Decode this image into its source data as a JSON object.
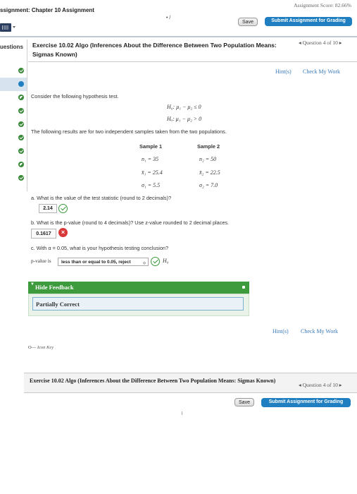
{
  "header": {
    "assignment_title": "ssignment: Chapter 10 Assignment",
    "score": "Assignment Score: 82.66%",
    "dots": "• /",
    "save_label": "Save",
    "submit_label": "Submit Assignment for Grading"
  },
  "sidebar": {
    "label": "uestions",
    "items": [
      {
        "status": "correct"
      },
      {
        "status": "current"
      },
      {
        "status": "partial"
      },
      {
        "status": "correct"
      },
      {
        "status": "correct"
      },
      {
        "status": "correct"
      },
      {
        "status": "correct"
      },
      {
        "status": "partial"
      },
      {
        "status": "correct"
      }
    ]
  },
  "exercise": {
    "title": "Exercise 10.02 Algo (Inferences About the Difference Between Two Population Means: Sigmas Known)",
    "question_nav": "◂ Question 4 of 10 ▸",
    "hints_label": "Hint(s)",
    "check_label": "Check My Work",
    "intro": "Consider the following hypothesis test.",
    "h0": "H₀: μ₁ − μ₂ ≤ 0",
    "ha": "Hₐ: μ₁ − μ₂ > 0",
    "samples_intro": "The following results are for two independent samples taken from the two populations.",
    "sample1_header": "Sample 1",
    "sample2_header": "Sample 2",
    "n1": "n₁ = 35",
    "n2": "n₂ = 50",
    "xbar1": "x̄₁ = 25.4",
    "xbar2": "x̄₂ = 22.5",
    "sigma1": "σ₁ = 5.5",
    "sigma2": "σ₂ = 7.0",
    "part_a": "a. What is the value of the test statistic (round to 2 decimals)?",
    "answer_a": "2.14",
    "part_b": "b. What is the p-value (round to 4 decimals)? Use z-value rounded to 2 decimal places.",
    "answer_b": "0.1617",
    "part_c": "c. With α = 0.05, what is your hypothesis testing conclusion?",
    "pvalue_label": "p-value is",
    "conclusion_select": "less than or equal to 0.05, reject",
    "h0_short": "H₀",
    "feedback_toggle": "Hide Feedback",
    "feedback_result": "Partially Correct",
    "icon_key": "Icon Key"
  },
  "footer": {
    "title": "Exercise 10.02 Algo (Inferences About the Difference Between Two Population Means: Sigmas Known)",
    "question_nav": "◂ Question 4 of 10 ▸",
    "save_label": "Save",
    "submit_label": "Submit Assignment for Grading"
  },
  "colors": {
    "accent_blue": "#1f7fc0",
    "correct_green": "#3a9a3a",
    "incorrect_red": "#d93838",
    "link_blue": "#3a7ab8"
  }
}
